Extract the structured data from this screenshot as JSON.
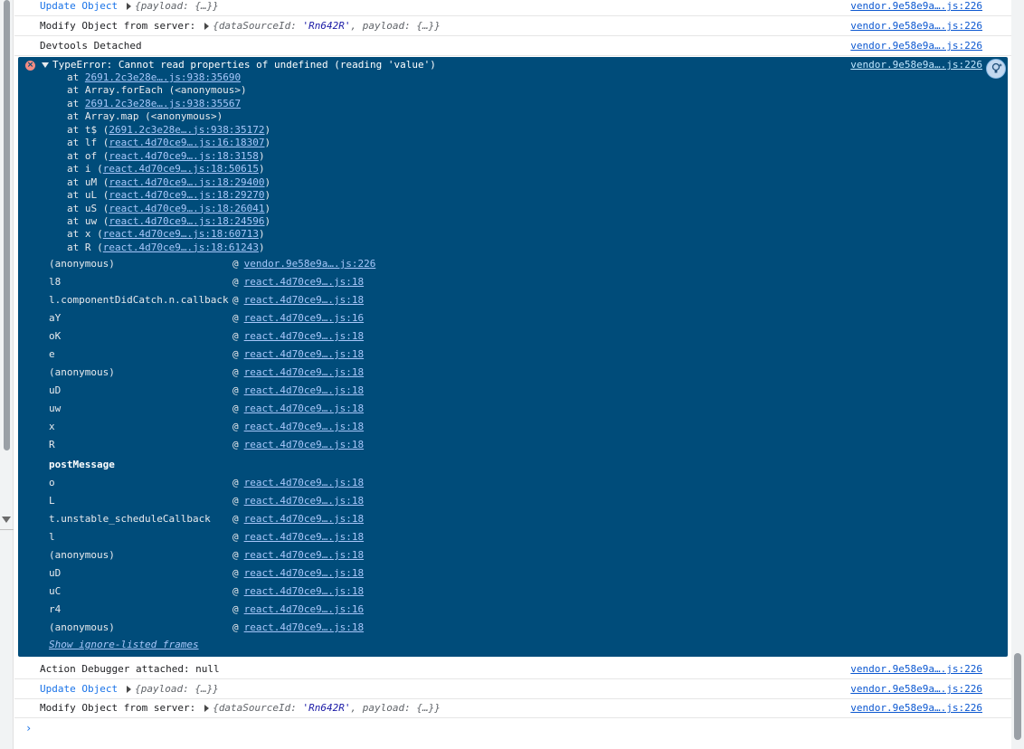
{
  "rows_top": [
    {
      "label": "Update Object",
      "obj": "{payload: {…}}",
      "src": "vendor.9e58e9a….js:226"
    },
    {
      "label": "Modify Object from server:",
      "obj_key1": "dataSourceId",
      "obj_val1": "'Rn642R'",
      "obj_key2": "payload",
      "obj_tail": "{…}}",
      "src": "vendor.9e58e9a….js:226"
    },
    {
      "label": "Devtools Detached",
      "src": "vendor.9e58e9a….js:226"
    }
  ],
  "error": {
    "message": "TypeError: Cannot read properties of undefined (reading 'value')",
    "src": "vendor.9e58e9a….js:226",
    "stack": [
      {
        "pre": "at ",
        "link": "2691.2c3e28e….js:938:35690",
        "post": ""
      },
      {
        "pre": "at Array.forEach (<anonymous>)",
        "link": "",
        "post": ""
      },
      {
        "pre": "at ",
        "link": "2691.2c3e28e….js:938:35567",
        "post": ""
      },
      {
        "pre": "at Array.map (<anonymous>)",
        "link": "",
        "post": ""
      },
      {
        "pre": "at t$ (",
        "link": "2691.2c3e28e….js:938:35172",
        "post": ")"
      },
      {
        "pre": "at lf (",
        "link": "react.4d70ce9….js:16:18307",
        "post": ")"
      },
      {
        "pre": "at of (",
        "link": "react.4d70ce9….js:18:3158",
        "post": ")"
      },
      {
        "pre": "at i (",
        "link": "react.4d70ce9….js:18:50615",
        "post": ")"
      },
      {
        "pre": "at uM (",
        "link": "react.4d70ce9….js:18:29400",
        "post": ")"
      },
      {
        "pre": "at uL (",
        "link": "react.4d70ce9….js:18:29270",
        "post": ")"
      },
      {
        "pre": "at uS (",
        "link": "react.4d70ce9….js:18:26041",
        "post": ")"
      },
      {
        "pre": "at uw (",
        "link": "react.4d70ce9….js:18:24596",
        "post": ")"
      },
      {
        "pre": "at x (",
        "link": "react.4d70ce9….js:18:60713",
        "post": ")"
      },
      {
        "pre": "at R (",
        "link": "react.4d70ce9….js:18:61243",
        "post": ")"
      }
    ],
    "frames_a": [
      {
        "fn": "(anonymous)",
        "src": "vendor.9e58e9a….js:226"
      },
      {
        "fn": "l8",
        "src": "react.4d70ce9….js:18"
      },
      {
        "fn": "l.componentDidCatch.n.callback",
        "src": "react.4d70ce9….js:18"
      },
      {
        "fn": "aY",
        "src": "react.4d70ce9….js:16"
      },
      {
        "fn": "oK",
        "src": "react.4d70ce9….js:18"
      },
      {
        "fn": "e",
        "src": "react.4d70ce9….js:18"
      },
      {
        "fn": "(anonymous)",
        "src": "react.4d70ce9….js:18"
      },
      {
        "fn": "uD",
        "src": "react.4d70ce9….js:18"
      },
      {
        "fn": "uw",
        "src": "react.4d70ce9….js:18"
      },
      {
        "fn": "x",
        "src": "react.4d70ce9….js:18"
      },
      {
        "fn": "R",
        "src": "react.4d70ce9….js:18"
      }
    ],
    "async_label": "postMessage",
    "frames_b": [
      {
        "fn": "o",
        "src": "react.4d70ce9….js:18"
      },
      {
        "fn": "L",
        "src": "react.4d70ce9….js:18"
      },
      {
        "fn": "t.unstable_scheduleCallback",
        "src": "react.4d70ce9….js:18"
      },
      {
        "fn": "l",
        "src": "react.4d70ce9….js:18"
      },
      {
        "fn": "(anonymous)",
        "src": "react.4d70ce9….js:18"
      },
      {
        "fn": "uD",
        "src": "react.4d70ce9….js:18"
      },
      {
        "fn": "uC",
        "src": "react.4d70ce9….js:18"
      },
      {
        "fn": "r4",
        "src": "react.4d70ce9….js:16"
      },
      {
        "fn": "(anonymous)",
        "src": "react.4d70ce9….js:18"
      }
    ],
    "ignore_label": "Show ignore-listed frames"
  },
  "rows_bottom": [
    {
      "label": "Action Debugger attached: null",
      "src": "vendor.9e58e9a….js:226"
    },
    {
      "label": "Update Object",
      "obj": "{payload: {…}}",
      "src": "vendor.9e58e9a….js:226"
    },
    {
      "label": "Modify Object from server:",
      "obj_key1": "dataSourceId",
      "obj_val1": "'Rn642R'",
      "obj_key2": "payload",
      "obj_tail": "{…}}",
      "src": "vendor.9e58e9a….js:226"
    }
  ],
  "prompt_symbol": "›",
  "at_symbol": "@",
  "colors": {
    "error_bg": "#004c7a",
    "link": "#a8c7fa",
    "group_label": "#1a73e8"
  }
}
